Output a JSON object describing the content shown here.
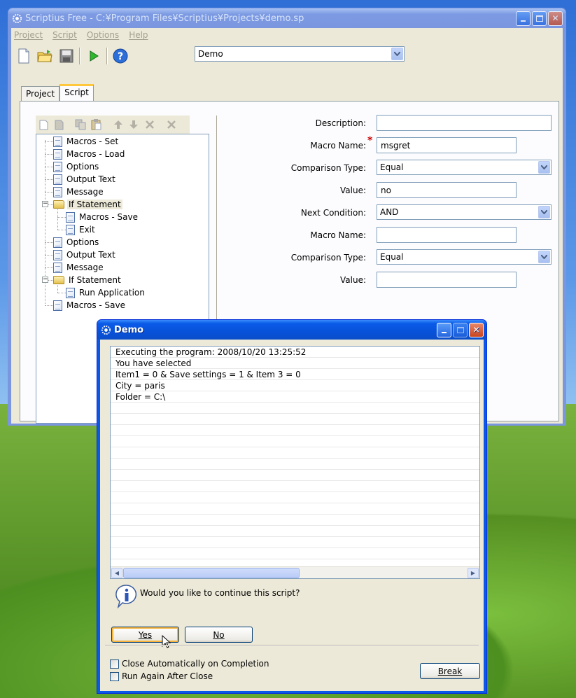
{
  "main_window": {
    "title": "Scriptius Free - C:¥Program Files¥Scriptius¥Projects¥demo.sp",
    "menu": [
      "Project",
      "Script",
      "Options",
      "Help"
    ],
    "toolbar": {
      "icons": [
        "new-icon",
        "open-folder-icon",
        "save-icon",
        "run-icon",
        "help-icon"
      ],
      "project_select": "Demo"
    },
    "tabs": [
      "Project",
      "Script"
    ],
    "active_tab": "Script",
    "tree_tools": [
      "new-icon",
      "paste-icon",
      "copy-icon",
      "clipboard-icon",
      "move-up-icon",
      "move-down-icon",
      "delete-icon",
      "clear-icon"
    ],
    "tree": [
      {
        "label": "Macros - Set",
        "type": "doc"
      },
      {
        "label": "Macros - Load",
        "type": "doc"
      },
      {
        "label": "Options",
        "type": "doc"
      },
      {
        "label": "Output Text",
        "type": "doc"
      },
      {
        "label": "Message",
        "type": "doc"
      },
      {
        "label": "If Statement",
        "type": "folder",
        "selected": true
      },
      {
        "label": "Macros - Save",
        "type": "doc",
        "child": true
      },
      {
        "label": "Exit",
        "type": "doc",
        "child": true
      },
      {
        "label": "Options",
        "type": "doc"
      },
      {
        "label": "Output Text",
        "type": "doc"
      },
      {
        "label": "Message",
        "type": "doc"
      },
      {
        "label": "If Statement",
        "type": "folder"
      },
      {
        "label": "Run Application",
        "type": "doc",
        "child": true
      },
      {
        "label": "Macros - Save",
        "type": "doc"
      }
    ],
    "form": {
      "description_label": "Description:",
      "description_value": "",
      "macro_name_label": "Macro Name:",
      "required_marker": "*",
      "macro_name_value": "msgret",
      "comparison_type_label": "Comparison Type:",
      "comparison_type_value": "Equal",
      "value_label": "Value:",
      "value_value": "no",
      "next_condition_label": "Next Condition:",
      "next_condition_value": "AND",
      "macro_name2_label": "Macro Name:",
      "macro_name2_value": "",
      "comparison_type2_label": "Comparison Type:",
      "comparison_type2_value": "Equal",
      "value2_label": "Value:",
      "value2_value": ""
    }
  },
  "dialog": {
    "title": "Demo",
    "output_lines": [
      "Executing the program: 2008/10/20 13:25:52",
      "You have selected",
      "Item1 = 0 & Save settings = 1 & Item 3 = 0",
      "City = paris",
      "Folder = C:\\"
    ],
    "question": "Would you like to continue this script?",
    "yes_button": "Yes",
    "no_button": "No",
    "close_auto_label": "Close Automatically on Completion",
    "run_again_label": "Run Again After Close",
    "break_button": "Break"
  },
  "colors": {
    "accent": "#0a58e8",
    "window_face": "#ece9d8",
    "tab_highlight": "#ffc83c",
    "required": "#cc0000"
  }
}
